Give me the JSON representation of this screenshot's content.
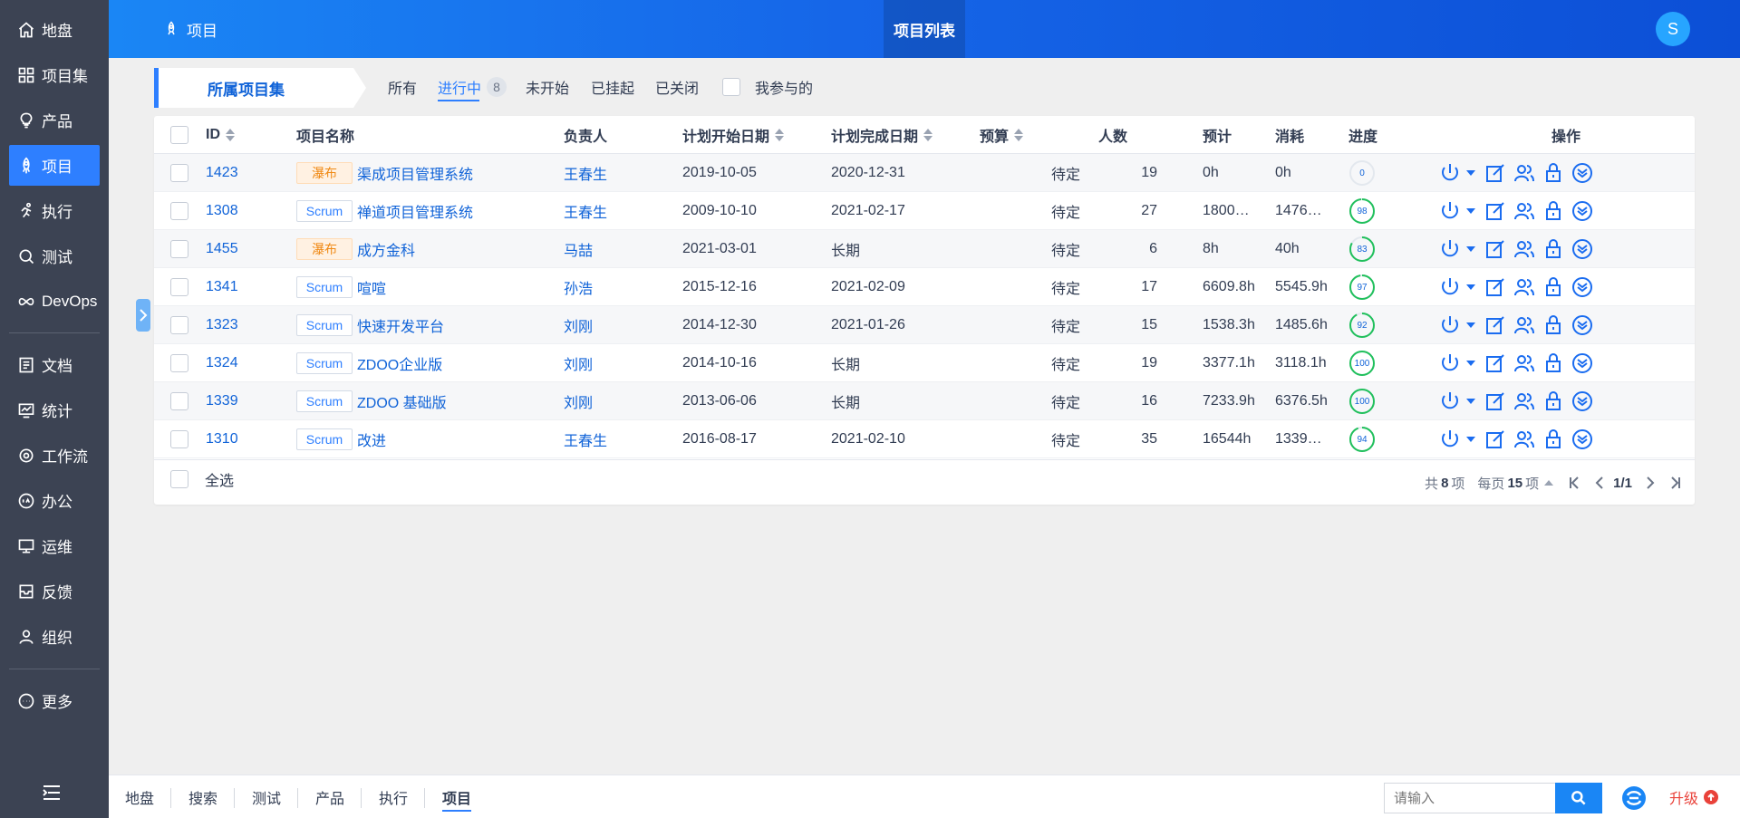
{
  "sidebar": {
    "items": [
      {
        "label": "地盘",
        "icon": "home-icon"
      },
      {
        "label": "项目集",
        "icon": "grid-icon"
      },
      {
        "label": "产品",
        "icon": "lightbulb-icon"
      },
      {
        "label": "项目",
        "icon": "rocket-icon",
        "active": true
      },
      {
        "label": "执行",
        "icon": "running-icon"
      },
      {
        "label": "测试",
        "icon": "bug-search-icon"
      },
      {
        "label": "DevOps",
        "icon": "infinity-icon"
      },
      {
        "label": "文档",
        "icon": "document-icon"
      },
      {
        "label": "统计",
        "icon": "chart-monitor-icon"
      },
      {
        "label": "工作流",
        "icon": "gear-icon"
      },
      {
        "label": "办公",
        "icon": "oa-icon"
      },
      {
        "label": "运维",
        "icon": "ops-icon"
      },
      {
        "label": "反馈",
        "icon": "feedback-icon"
      },
      {
        "label": "组织",
        "icon": "user-icon"
      },
      {
        "label": "更多",
        "icon": "more-icon"
      }
    ]
  },
  "header": {
    "app_label": "项目",
    "active_tab": "项目列表",
    "avatar_letter": "S"
  },
  "filter": {
    "program_label": "所属项目集",
    "tabs": [
      {
        "label": "所有"
      },
      {
        "label": "进行中",
        "count": "8",
        "active": true
      },
      {
        "label": "未开始"
      },
      {
        "label": "已挂起"
      },
      {
        "label": "已关闭"
      }
    ],
    "mine_label": "我参与的"
  },
  "table": {
    "headers": {
      "id": "ID",
      "name": "项目名称",
      "owner": "负责人",
      "begin": "计划开始日期",
      "end": "计划完成日期",
      "budget": "预算",
      "members": "人数",
      "estimate": "预计",
      "consumed": "消耗",
      "progress": "进度",
      "actions": "操作"
    },
    "rows": [
      {
        "id": "1423",
        "type": "瀑布",
        "type_kind": "waterfall",
        "name": "渠成项目管理系统",
        "owner": "王春生",
        "begin": "2019-10-05",
        "end": "2020-12-31",
        "budget": "待定",
        "members": "19",
        "estimate": "0h",
        "consumed": "0h",
        "progress": "0",
        "progress_value": 0
      },
      {
        "id": "1308",
        "type": "Scrum",
        "type_kind": "scrum",
        "name": "禅道项目管理系统",
        "owner": "王春生",
        "begin": "2009-10-10",
        "end": "2021-02-17",
        "budget": "待定",
        "members": "27",
        "estimate": "1800…",
        "consumed": "1476…",
        "progress": "98",
        "progress_value": 98
      },
      {
        "id": "1455",
        "type": "瀑布",
        "type_kind": "waterfall",
        "name": "成方金科",
        "owner": "马喆",
        "begin": "2021-03-01",
        "end": "长期",
        "budget": "待定",
        "members": "6",
        "estimate": "8h",
        "consumed": "40h",
        "progress": "83",
        "progress_value": 83
      },
      {
        "id": "1341",
        "type": "Scrum",
        "type_kind": "scrum",
        "name": "喧喧",
        "owner": "孙浩",
        "begin": "2015-12-16",
        "end": "2021-02-09",
        "budget": "待定",
        "members": "17",
        "estimate": "6609.8h",
        "consumed": "5545.9h",
        "progress": "97",
        "progress_value": 97
      },
      {
        "id": "1323",
        "type": "Scrum",
        "type_kind": "scrum",
        "name": "快速开发平台",
        "owner": "刘刚",
        "begin": "2014-12-30",
        "end": "2021-01-26",
        "budget": "待定",
        "members": "15",
        "estimate": "1538.3h",
        "consumed": "1485.6h",
        "progress": "92",
        "progress_value": 92
      },
      {
        "id": "1324",
        "type": "Scrum",
        "type_kind": "scrum",
        "name": "ZDOO企业版",
        "owner": "刘刚",
        "begin": "2014-10-16",
        "end": "长期",
        "budget": "待定",
        "members": "19",
        "estimate": "3377.1h",
        "consumed": "3118.1h",
        "progress": "100",
        "progress_value": 100
      },
      {
        "id": "1339",
        "type": "Scrum",
        "type_kind": "scrum",
        "name": "ZDOO 基础版",
        "owner": "刘刚",
        "begin": "2013-06-06",
        "end": "长期",
        "budget": "待定",
        "members": "16",
        "estimate": "7233.9h",
        "consumed": "6376.5h",
        "progress": "100",
        "progress_value": 100
      },
      {
        "id": "1310",
        "type": "Scrum",
        "type_kind": "scrum",
        "name": "改进",
        "owner": "王春生",
        "begin": "2016-08-17",
        "end": "2021-02-10",
        "budget": "待定",
        "members": "35",
        "estimate": "16544h",
        "consumed": "1339…",
        "progress": "94",
        "progress_value": 94
      }
    ],
    "action_icons": [
      "power-icon",
      "edit-icon",
      "members-icon",
      "lock-icon",
      "more-circle-icon"
    ]
  },
  "footer": {
    "select_all": "全选",
    "total_prefix": "共",
    "total": "8",
    "total_suffix": "项",
    "per_page_prefix": "每页",
    "per_page": "15",
    "per_page_suffix": "项",
    "page": "1/1"
  },
  "bottombar": {
    "tabs": [
      {
        "label": "地盘"
      },
      {
        "label": "搜索"
      },
      {
        "label": "测试"
      },
      {
        "label": "产品"
      },
      {
        "label": "执行"
      },
      {
        "label": "项目",
        "active": true
      }
    ],
    "search_placeholder": "请输入",
    "upgrade_label": "升级"
  },
  "colors": {
    "primary": "#2e7fff",
    "sidebar_bg": "#3c4353",
    "progress_green": "#20c05c",
    "waterfall_orange": "#f08a16",
    "upgrade_red": "#e9423a"
  }
}
